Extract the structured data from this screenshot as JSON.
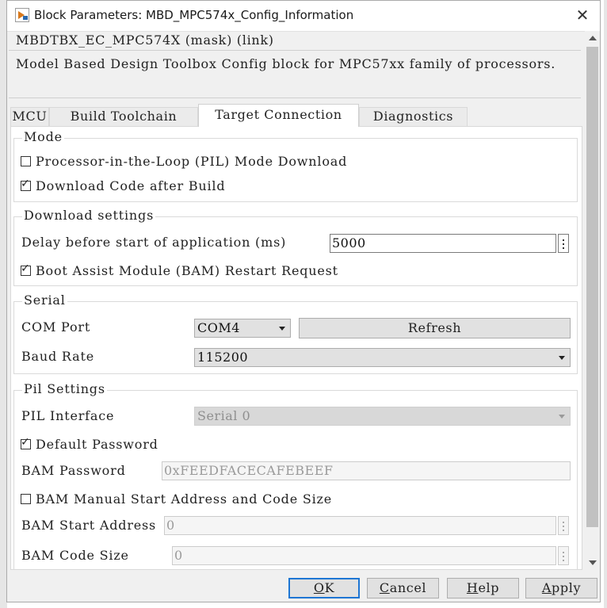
{
  "window": {
    "title": "Block Parameters: MBD_MPC574x_Config_Information",
    "close_glyph": "✕"
  },
  "header": {
    "mask_name": "MBDTBX_EC_MPC574X (mask) (link)",
    "description": "Model Based Design Toolbox Config block for MPC57xx family of processors."
  },
  "tabs": [
    {
      "label": "MCU",
      "active": false
    },
    {
      "label": "Build Toolchain",
      "active": false
    },
    {
      "label": "Target Connection",
      "active": true
    },
    {
      "label": "Diagnostics",
      "active": false
    }
  ],
  "mode": {
    "title": "Mode",
    "pil_download": {
      "label": "Processor-in-the-Loop (PIL) Mode Download",
      "checked": false
    },
    "download_after_build": {
      "label": "Download Code after Build",
      "checked": true
    }
  },
  "download_settings": {
    "title": "Download settings",
    "delay_label": "Delay before start of application (ms)",
    "delay_value": "5000",
    "bam_restart": {
      "label": "Boot Assist Module (BAM) Restart Request",
      "checked": true
    }
  },
  "serial": {
    "title": "Serial",
    "com_port_label": "COM Port",
    "com_port_value": "COM4",
    "refresh_label": "Refresh",
    "baud_rate_label": "Baud Rate",
    "baud_rate_value": "115200"
  },
  "pil_settings": {
    "title": "Pil Settings",
    "interface_label": "PIL Interface",
    "interface_value": "Serial 0",
    "default_password": {
      "label": "Default Password",
      "checked": true
    },
    "bam_password_label": "BAM Password",
    "bam_password_value": "0xFEEDFACECAFEBEEF",
    "bam_manual": {
      "label": "BAM Manual Start Address and Code Size",
      "checked": false
    },
    "bam_start_label": "BAM Start Address",
    "bam_start_value": "0",
    "bam_code_size_label": "BAM Code Size",
    "bam_code_size_value": "0"
  },
  "buttons": {
    "ok": {
      "label": "OK",
      "mnemonic": "O",
      "rest": "K"
    },
    "cancel": {
      "label": "Cancel",
      "mnemonic": "C",
      "rest": "ancel"
    },
    "help": {
      "label": "Help",
      "mnemonic": "H",
      "rest": "elp"
    },
    "apply": {
      "label": "Apply",
      "mnemonic": "A",
      "rest": "pply"
    }
  },
  "check_glyph": "✓",
  "colors": {
    "accent": "#1e76d3"
  }
}
